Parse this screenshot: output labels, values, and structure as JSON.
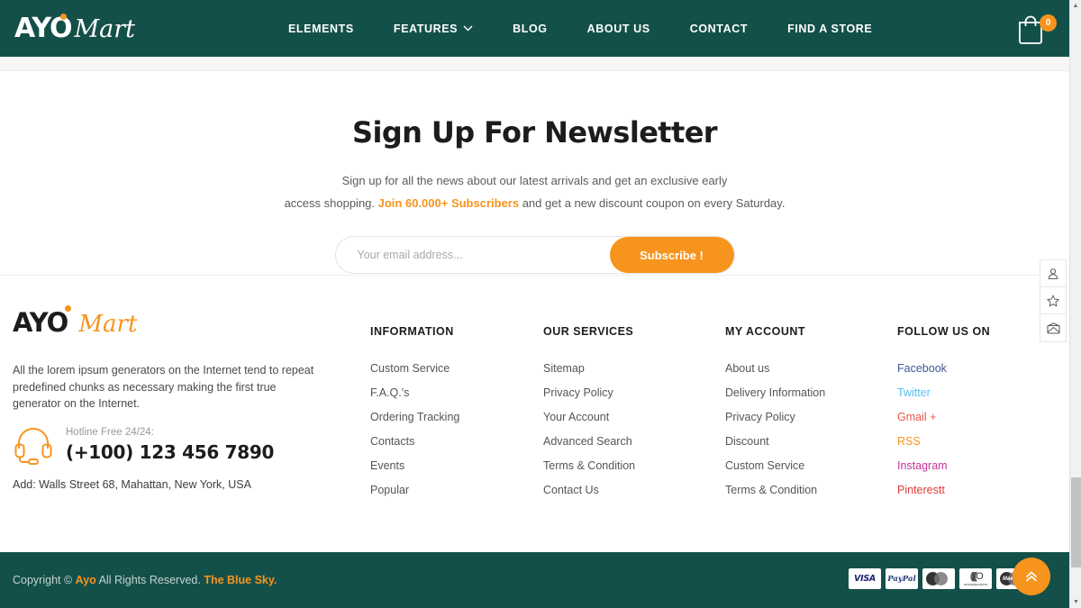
{
  "header": {
    "logo": {
      "main": "AYO",
      "script": "Mart"
    },
    "nav": [
      {
        "label": "ELEMENTS",
        "has_caret": false
      },
      {
        "label": "FEATURES",
        "has_caret": true
      },
      {
        "label": "BLOG",
        "has_caret": false
      },
      {
        "label": "ABOUT US",
        "has_caret": false
      },
      {
        "label": "CONTACT",
        "has_caret": false
      },
      {
        "label": "FIND A STORE",
        "has_caret": false
      }
    ],
    "cart": {
      "icon": "shopping-bag-icon",
      "count": "0"
    },
    "bg_color": "#14504a"
  },
  "newsletter": {
    "title": "Sign Up For Newsletter",
    "line1": "Sign up for all the news about our latest arrivals and get an exclusive early",
    "line2_before": "access shopping. ",
    "line2_highlight": "Join 60.000+ Subscribers",
    "line2_after": " and get a new discount coupon on every Saturday.",
    "email_placeholder": "Your email address...",
    "email_value": "",
    "subscribe_label": "Subscribe !",
    "accent_color": "#f7941e"
  },
  "footer": {
    "logo": {
      "main": "AYO",
      "script": "Mart"
    },
    "description": "All the lorem ipsum generators on the Internet tend to repeat predefined chunks as necessary making the first true generator on the Internet.",
    "hotline_label": "Hotline Free 24/24:",
    "hotline_number": "(+100) 123 456 7890",
    "address": "Add: Walls Street 68, Mahattan, New York, USA",
    "columns": [
      {
        "title": "INFORMATION",
        "links": [
          "Custom Service",
          "F.A.Q.'s",
          "Ordering Tracking",
          "Contacts",
          "Events",
          "Popular"
        ]
      },
      {
        "title": "OUR SERVICES",
        "links": [
          "Sitemap",
          "Privacy Policy",
          "Your Account",
          "Advanced Search",
          "Terms & Condition",
          "Contact Us"
        ]
      },
      {
        "title": "MY ACCOUNT",
        "links": [
          "About us",
          "Delivery Information",
          "Privacy Policy",
          "Discount",
          "Custom Service",
          "Terms & Condition"
        ]
      }
    ],
    "social": {
      "title": "FOLLOW US ON",
      "links": [
        {
          "label": "Facebook",
          "color": "#3b5998"
        },
        {
          "label": "Twitter",
          "color": "#55c1ee"
        },
        {
          "label": "Gmail +",
          "color": "#e8584a"
        },
        {
          "label": "RSS",
          "color": "#f7941e"
        },
        {
          "label": "Instagram",
          "color": "#c9339b"
        },
        {
          "label": "Pinterestt",
          "color": "#e03a3a"
        }
      ]
    }
  },
  "bottom": {
    "copyright_before": "Copyright © ",
    "copyright_brand": "Ayo",
    "copyright_mid": " All Rights Reserved. ",
    "copyright_link": "The Blue Sky.",
    "payments": [
      {
        "name": "VISA"
      },
      {
        "name": "PayPal"
      },
      {
        "name": "MasterCard"
      },
      {
        "name": "moneybookers"
      },
      {
        "name": "Maestro"
      }
    ],
    "scroll_top_icon": "chevron-double-up-icon"
  },
  "side_tools": [
    {
      "icon": "user-icon",
      "name": "account"
    },
    {
      "icon": "star-icon",
      "name": "wishlist"
    },
    {
      "icon": "envelope-icon",
      "name": "messages"
    }
  ]
}
